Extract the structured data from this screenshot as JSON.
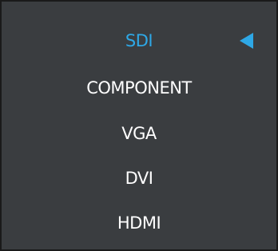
{
  "menu": {
    "items": [
      {
        "label": "SDI",
        "selected": true
      },
      {
        "label": "COMPONENT",
        "selected": false
      },
      {
        "label": "VGA",
        "selected": false
      },
      {
        "label": "DVI",
        "selected": false
      },
      {
        "label": "HDMI",
        "selected": false
      }
    ],
    "selected_index": 0,
    "indicator_icon": "triangle-left-icon"
  },
  "colors": {
    "background": "#3a3d40",
    "border": "#1a1a1a",
    "text": "#ffffff",
    "accent": "#2ea8e6"
  }
}
